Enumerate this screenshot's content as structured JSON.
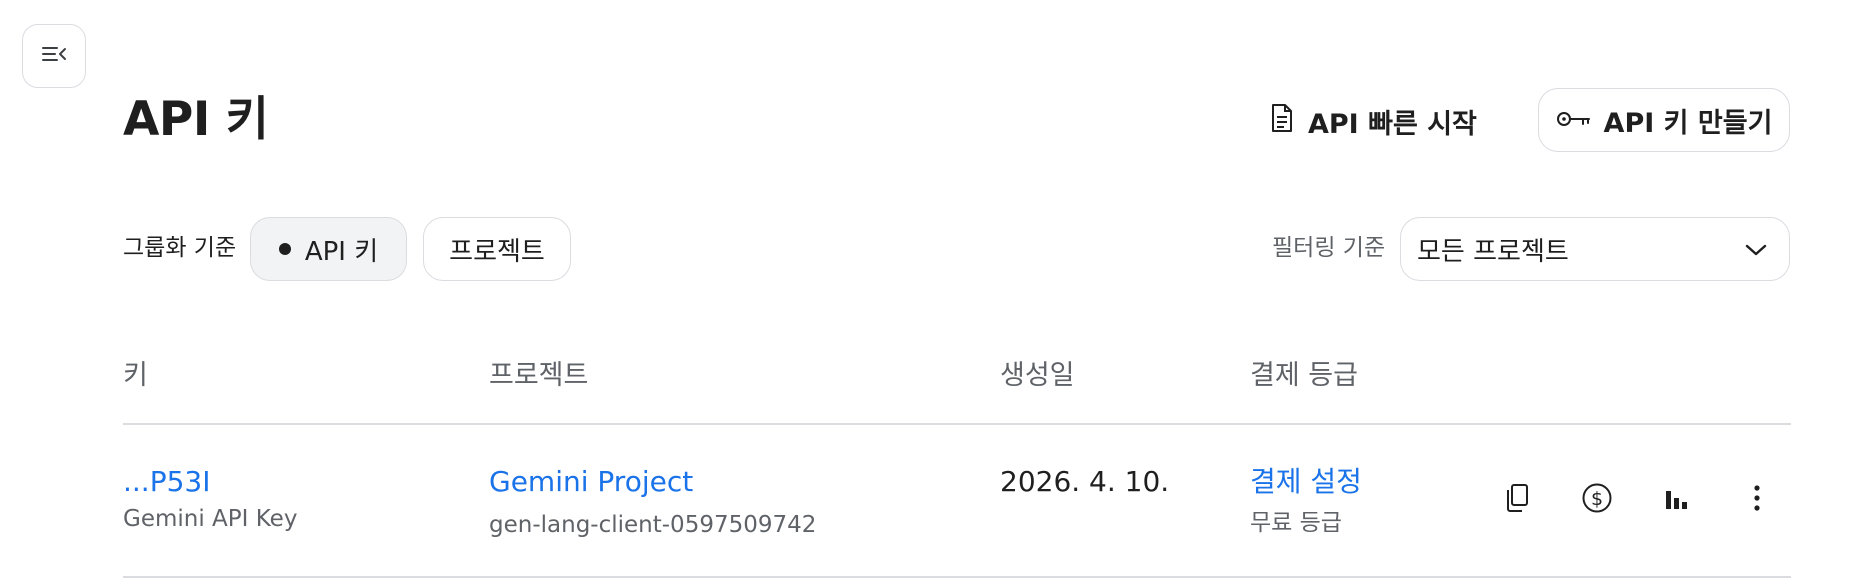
{
  "header": {
    "title": "API 키",
    "quickstart_label": "API 빠른 시작",
    "create_key_label": "API 키 만들기"
  },
  "toolbar": {
    "group_label": "그룹화 기준",
    "group_options": [
      "API 키",
      "프로젝트"
    ],
    "group_selected": "API 키",
    "filter_label": "필터링 기준",
    "filter_value": "모든 프로젝트"
  },
  "table": {
    "columns": [
      "키",
      "프로젝트",
      "생성일",
      "결제 등급"
    ],
    "rows": [
      {
        "key": "...P53I",
        "key_name": "Gemini API Key",
        "project": "Gemini Project",
        "project_id": "gen-lang-client-0597509742",
        "created": "2026. 4. 10.",
        "billing_link": "결제 설정",
        "billing_tier": "무료 등급"
      }
    ]
  },
  "icons": {
    "sidebar_toggle": "menu-collapse-icon",
    "quickstart": "document-icon",
    "create_key": "key-icon",
    "filter": "chevron-down-icon",
    "row_actions": [
      "copy-icon",
      "dollar-icon",
      "bar-chart-icon",
      "more-vert-icon"
    ]
  },
  "colors": {
    "link": "#1a73e8",
    "text": "#1f1f1f",
    "muted": "#5f6368",
    "border": "#dadce0"
  }
}
